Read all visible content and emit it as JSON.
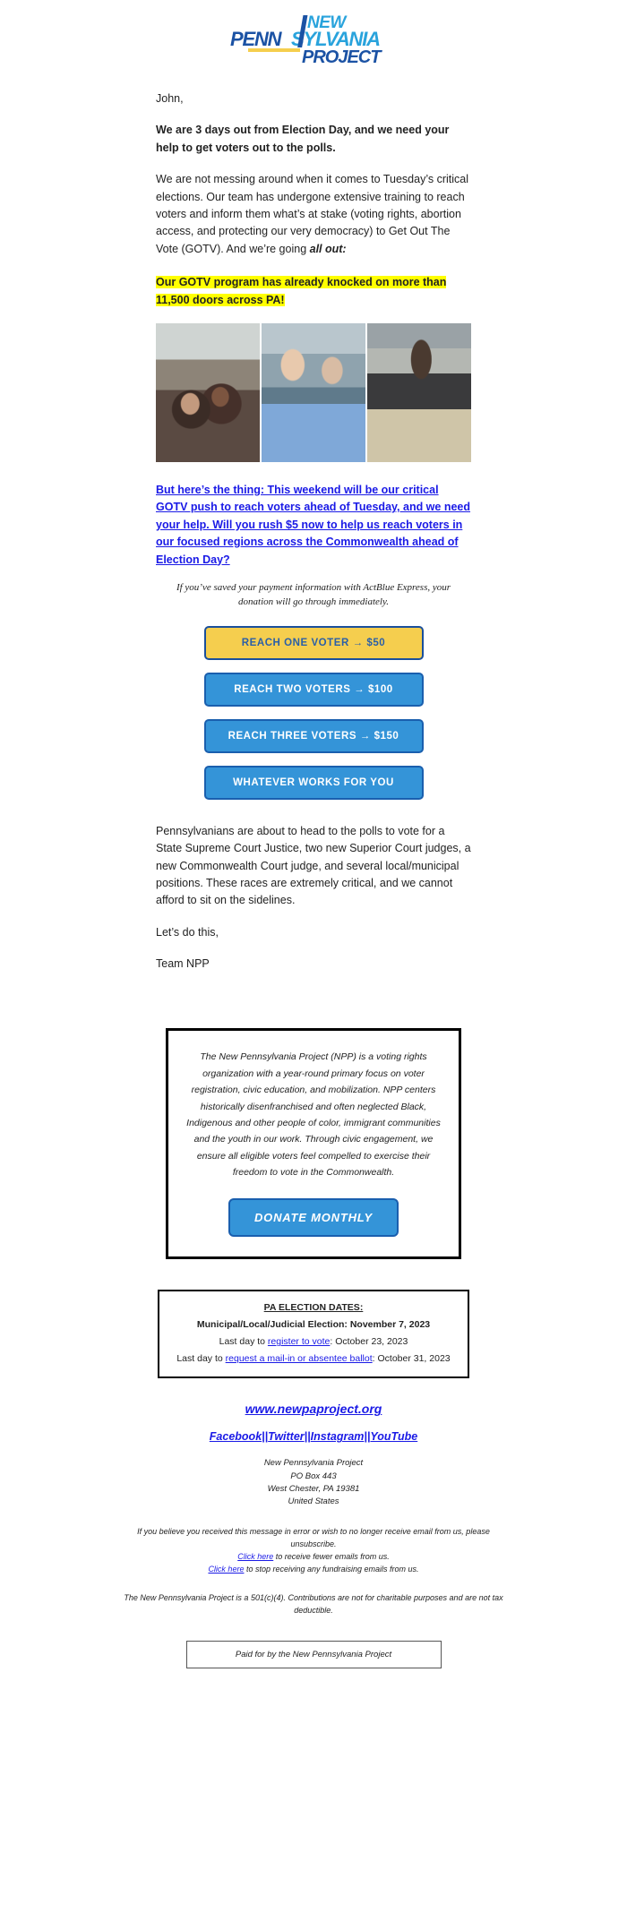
{
  "logo": {
    "line1": "NEW",
    "line2": "PENNSYLVANIA",
    "line3": "PROJECT",
    "blue_dark": "#1b52a4",
    "blue_light": "#29a3dc",
    "accent_yellow": "#f5ce4e"
  },
  "body": {
    "greeting": "John,",
    "headline": "We are 3 days out from Election Day, and we need your help to get voters out to the polls.",
    "paragraph_1_part1": "We are not messing around when it comes to Tuesday’s critical elections. Our team has undergone extensive training to reach voters and inform them what’s at stake (voting rights, abortion access, and protecting our very democracy) to Get Out The Vote (GOTV). And we’re going ",
    "paragraph_1_emphasis": "all out:",
    "highlight": "Our GOTV program has already knocked on more than 11,500 doors across PA!",
    "big_link": "But here’s the thing: This weekend will be our critical GOTV push to reach voters ahead of Tuesday, and we need your help. Will you rush $5 now to help us reach voters in our focused regions across the Commonwealth ahead of Election Day?",
    "actblue_note": "If you’ve saved your payment information with ActBlue Express, your donation will go through immediately.",
    "closing_paragraph": "Pennsylvanians are about to head to the polls to vote for a State Supreme Court Justice, two new Superior Court judges, a new Commonwealth Court judge, and several local/municipal positions. These races are extremely critical, and we cannot afford to sit on the sidelines.",
    "signoff_line1": "Let’s do this,",
    "signoff_line2": "Team NPP"
  },
  "photos": [
    {
      "alt": "two volunteers smiling selfie on porch"
    },
    {
      "alt": "two canvassers in New Pennsylvania Project shirts"
    },
    {
      "alt": "canvasser holding clipboard outside store"
    }
  ],
  "donate_buttons": [
    {
      "label": "REACH ONE VOTER → $50",
      "style": "yellow"
    },
    {
      "label": "REACH TWO VOTERS → $100",
      "style": "blue"
    },
    {
      "label": "REACH THREE VOTERS → $150",
      "style": "blue"
    },
    {
      "label": "WHATEVER WORKS FOR YOU",
      "style": "blue"
    }
  ],
  "about_box": {
    "text": "The New Pennsylvania Project (NPP) is a voting rights organization with a year-round primary focus on voter registration, civic education, and mobilization. NPP centers historically disenfranchised and often neglected Black, Indigenous and other people of color, immigrant communities and the youth in our work. Through civic engagement, we ensure all eligible voters feel compelled to exercise their freedom to vote in the Commonwealth.",
    "donate_monthly_label": "DONATE MONTHLY"
  },
  "election_dates": {
    "title": "PA ELECTION DATES:",
    "subtitle": "Municipal/Local/Judicial Election: November 7, 2023",
    "row1_prefix": "Last day to ",
    "row1_link": "register to vote",
    "row1_suffix": ": October 23, 2023",
    "row2_prefix": "Last day to ",
    "row2_link": "request a mail-in or absentee ballot",
    "row2_suffix": ": October 31, 2023"
  },
  "footer": {
    "website": "www.newpaproject.org",
    "social": [
      {
        "label": "Facebook"
      },
      {
        "label": "Twitter"
      },
      {
        "label": "Instagram"
      },
      {
        "label": "YouTube"
      }
    ],
    "social_separator": "||",
    "address_line1": "New Pennsylvania Project",
    "address_line2": "PO Box 443",
    "address_line3": "West Chester, PA 19381",
    "address_line4": "United States",
    "disclaimer_line1": "If you believe you received this message in error or wish to no longer receive email from us, please unsubscribe.",
    "fewer_emails_link": "Click here",
    "fewer_emails_text": " to receive fewer emails from us.",
    "stop_fundraising_link": "Click here",
    "stop_fundraising_text": " to stop receiving any fundraising emails from us.",
    "tax_disclaimer": "The New Pennsylvania Project is a 501(c)(4). Contributions are not for charitable purposes and are not tax deductible.",
    "paid_for": "Paid for by the New Pennsylvania Project"
  }
}
